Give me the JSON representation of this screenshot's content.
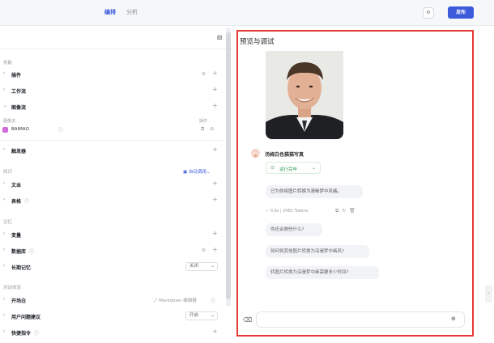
{
  "topbar": {
    "tab_arrange": "编排",
    "tab_analysis": "分析",
    "settings_icon": "gear-icon",
    "publish": "发布"
  },
  "left": {
    "sections": {
      "skills": "技能",
      "knowledge": "知识",
      "memory": "记忆",
      "dialog": "对话体验"
    },
    "rows": {
      "plugin": "插件",
      "workflow": "工作流",
      "imageflow": "图像流",
      "trigger": "触发器",
      "text": "文本",
      "table": "表格",
      "variable": "变量",
      "database": "数据库",
      "long_memory": "长期记忆",
      "opening": "开场白",
      "suggest": "用户问题建议",
      "shortcut": "快捷指令"
    },
    "imageflow_header": {
      "col_name": "图像流",
      "col_ops": "操作"
    },
    "imageflow_item": "BAIMAO",
    "auto_call": "自动调用",
    "long_memory_value": "关闭",
    "suggest_value": "开启",
    "markdown_editor": "Markdown 编辑器"
  },
  "right": {
    "title": "预览与调试",
    "bot_name": "汤姆白色猫猫写真",
    "status": "运行完毕",
    "reply": "已为你将图片转换为清晰梦中风格。",
    "stats": "0.9s | 2481 Tokens",
    "suggestions": [
      "你还会做些什么?",
      "如何将其他图片转换为深邃梦中画风?",
      "转图片转换为深邃梦中画需要多少时间?"
    ]
  }
}
